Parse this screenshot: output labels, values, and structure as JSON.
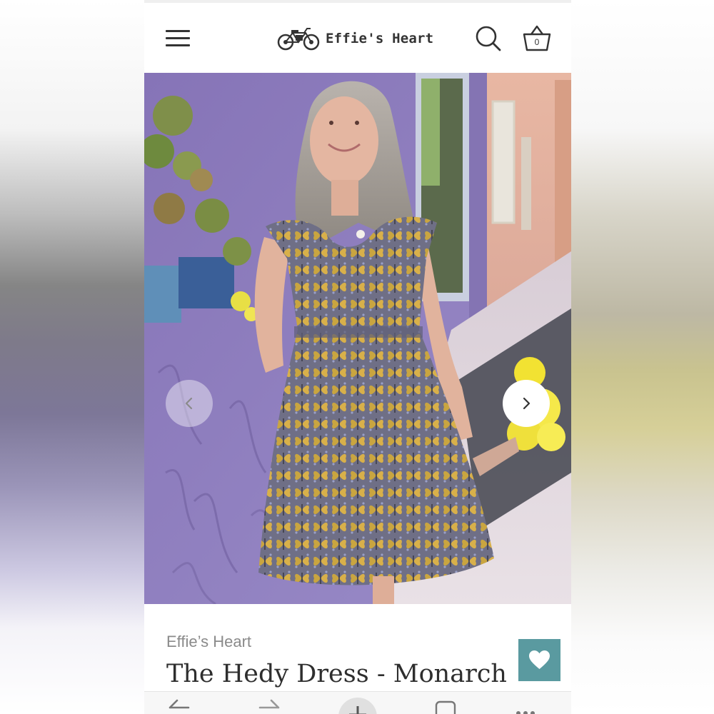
{
  "header": {
    "logo_text": "Effie's Heart",
    "cart_count": "0",
    "menu_icon": "hamburger-menu-icon",
    "search_icon": "search-icon",
    "cart_icon": "basket-icon"
  },
  "hero": {
    "description_icon": "product-photo",
    "prev_icon": "chevron-left-icon",
    "next_icon": "chevron-right-icon"
  },
  "product": {
    "vendor": "Effie’s Heart",
    "title": "The Hedy Dress - Monarch",
    "wishlist_icon": "heart-icon"
  },
  "toolbar": {
    "items": [
      "back-arrow-icon",
      "forward-arrow-icon",
      "new-tab-plus-icon",
      "tabs-icon",
      "more-dots-icon"
    ]
  },
  "colors": {
    "accent_teal": "#5a9aa0",
    "text_dark": "#2e2e2e",
    "text_muted": "#8a8a8a"
  }
}
